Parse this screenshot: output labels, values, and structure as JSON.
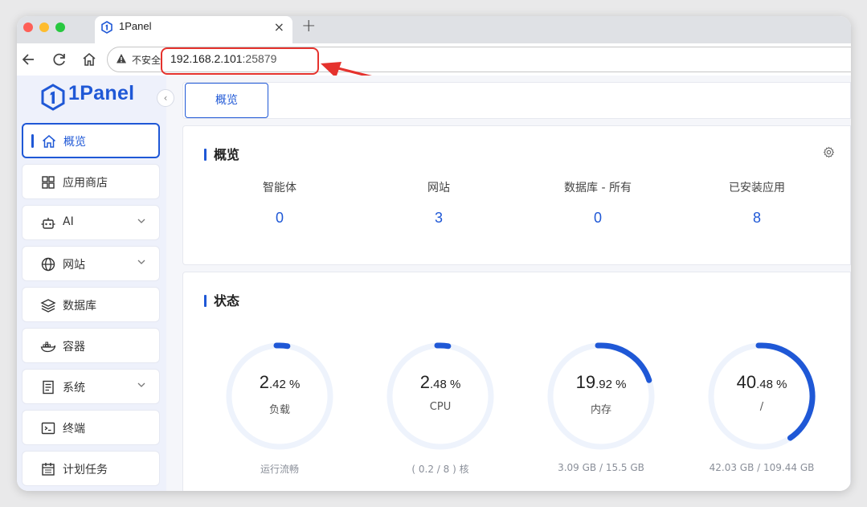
{
  "browser": {
    "tab_title": "1Panel",
    "tab_close": "×",
    "new_tab": "+",
    "insecure_label": "不安全",
    "url_host": "192.168.2.101",
    "url_port": ":25879"
  },
  "sidebar": {
    "logo_text": "1Panel",
    "collapse_icon": "‹",
    "items": [
      {
        "label": "概览",
        "icon": "home-icon",
        "active": true
      },
      {
        "label": "应用商店",
        "icon": "apps-grid-icon"
      },
      {
        "label": "AI",
        "icon": "robot-icon",
        "expandable": true
      },
      {
        "label": "网站",
        "icon": "globe-icon",
        "expandable": true
      },
      {
        "label": "数据库",
        "icon": "layers-icon"
      },
      {
        "label": "容器",
        "icon": "docker-icon"
      },
      {
        "label": "系统",
        "icon": "server-icon",
        "expandable": true
      },
      {
        "label": "终端",
        "icon": "terminal-icon"
      },
      {
        "label": "计划任务",
        "icon": "calendar-icon"
      }
    ]
  },
  "main": {
    "tab_label": "概览",
    "overview": {
      "title": "概览",
      "stats": [
        {
          "label": "智能体",
          "value": "0"
        },
        {
          "label": "网站",
          "value": "3"
        },
        {
          "label": "数据库 - 所有",
          "value": "0"
        },
        {
          "label": "已安装应用",
          "value": "8"
        }
      ]
    },
    "status": {
      "title": "状态",
      "gauges": [
        {
          "int": "2",
          "dec": ".42 %",
          "percent": 2.42,
          "label": "负载",
          "footer": "运行流畅"
        },
        {
          "int": "2",
          "dec": ".48 %",
          "percent": 2.48,
          "label": "CPU",
          "footer": "( 0.2 / 8 ) 核"
        },
        {
          "int": "19",
          "dec": ".92 %",
          "percent": 19.92,
          "label": "内存",
          "footer": "3.09 GB / 15.5 GB"
        },
        {
          "int": "40",
          "dec": ".48 %",
          "percent": 40.48,
          "label": "/",
          "footer": "42.03 GB / 109.44 GB"
        }
      ]
    }
  },
  "colors": {
    "accent": "#1f58d6",
    "gauge_track": "#eef3fc",
    "annotation": "#e5322d"
  }
}
